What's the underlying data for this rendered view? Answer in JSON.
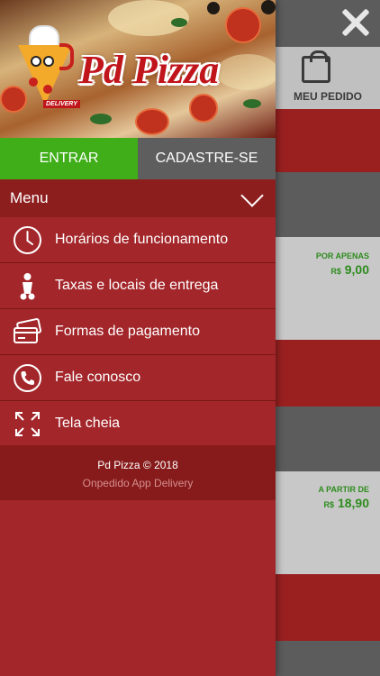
{
  "background_app": {
    "order_tab_label": "MEU PEDIDO",
    "price1_caption": "POR APENAS",
    "price1_currency": "R$",
    "price1_value": "9,00",
    "price2_caption": "A PARTIR DE",
    "price2_currency": "R$",
    "price2_value": "18,90"
  },
  "header": {
    "logo_text": "Pd Pizza",
    "delivery_tag": "DELIVERY"
  },
  "auth": {
    "enter_label": "ENTRAR",
    "signup_label": "CADASTRE-SE"
  },
  "menu": {
    "title": "Menu",
    "items": [
      {
        "label": "Horários de funcionamento",
        "icon": "clock-icon"
      },
      {
        "label": "Taxas e locais de entrega",
        "icon": "scooter-icon"
      },
      {
        "label": "Formas de pagamento",
        "icon": "credit-card-icon"
      },
      {
        "label": "Fale conosco",
        "icon": "phone-icon"
      },
      {
        "label": "Tela cheia",
        "icon": "fullscreen-icon"
      }
    ]
  },
  "footer": {
    "copyright": "Pd Pizza © 2018",
    "powered_by": "Onpedido App Delivery"
  },
  "colors": {
    "drawer_red": "#a3262a",
    "enter_green": "#3fae18",
    "signup_grey": "#5e5e5e",
    "price_green": "#2e8c1e"
  }
}
